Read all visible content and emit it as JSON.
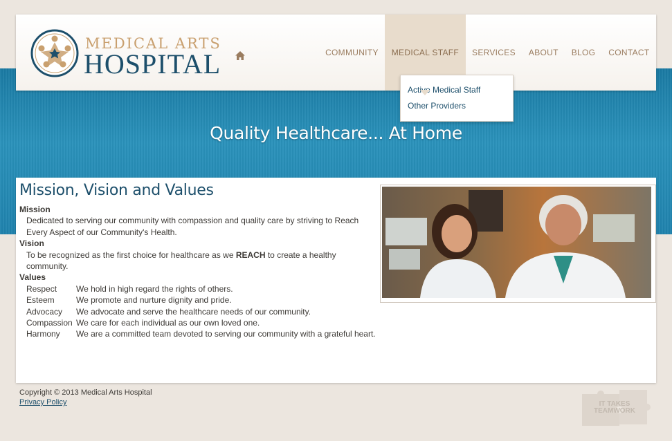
{
  "brand": {
    "name_line1": "MEDICAL ARTS",
    "name_line2": "HOSPITAL",
    "colors": {
      "navy": "#1d4f6b",
      "tan": "#c9a06f",
      "blue_band": "#1f82ad"
    }
  },
  "nav": {
    "home_icon": "home-icon",
    "items": [
      {
        "label": "COMMUNITY"
      },
      {
        "label": "MEDICAL STAFF"
      },
      {
        "label": "SERVICES"
      },
      {
        "label": "ABOUT"
      },
      {
        "label": "BLOG"
      },
      {
        "label": "CONTACT"
      }
    ],
    "active_index": 1,
    "dropdown": [
      {
        "label": "Active Medical Staff"
      },
      {
        "label": "Other Providers"
      }
    ]
  },
  "hero": {
    "tagline": "Quality Healthcare... At Home"
  },
  "main": {
    "title": "Mission, Vision and Values",
    "mission": {
      "heading": "Mission",
      "text_1": "Dedicated to serving our community with compassion and quality care by striving to Reach",
      "text_2": "Every Aspect of our Community's Health."
    },
    "vision": {
      "heading": "Vision",
      "text_before": "To be recognized as the first choice for healthcare as we ",
      "text_bold": "REACH",
      "text_after": " to create a healthy community."
    },
    "values": {
      "heading": "Values",
      "items": [
        {
          "term": "Respect",
          "desc": "We hold in high regard the rights of others."
        },
        {
          "term": "Esteem",
          "desc": "We promote and nurture dignity and pride."
        },
        {
          "term": "Advocacy",
          "desc": "We advocate and serve the healthcare needs of our community."
        },
        {
          "term": "Compassion",
          "desc": "We care for each individual as our own loved one."
        },
        {
          "term": "Harmony",
          "desc": "We are a committed team devoted to serving our community with a grateful heart."
        }
      ]
    }
  },
  "footer": {
    "copyright": "Copyright © 2013 Medical Arts Hospital",
    "privacy_link": "Privacy Policy",
    "badge_line1": "IT TAKES",
    "badge_line2": "TEAMWORK"
  }
}
